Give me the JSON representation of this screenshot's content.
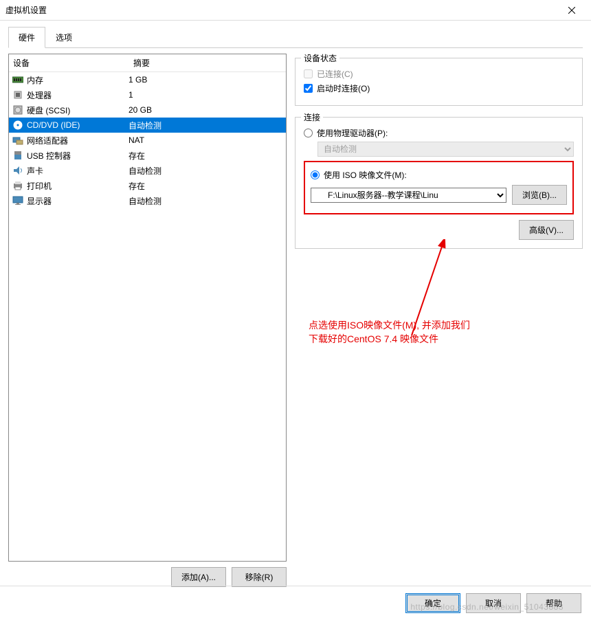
{
  "window": {
    "title": "虚拟机设置"
  },
  "tabs": {
    "hardware": "硬件",
    "options": "选项"
  },
  "hw_header": {
    "device": "设备",
    "summary": "摘要"
  },
  "hw_items": [
    {
      "name": "内存",
      "summary": "1 GB",
      "icon": "memory"
    },
    {
      "name": "处理器",
      "summary": "1",
      "icon": "cpu"
    },
    {
      "name": "硬盘 (SCSI)",
      "summary": "20 GB",
      "icon": "disk"
    },
    {
      "name": "CD/DVD (IDE)",
      "summary": "自动检测",
      "icon": "cd",
      "selected": true
    },
    {
      "name": "网络适配器",
      "summary": "NAT",
      "icon": "net"
    },
    {
      "name": "USB 控制器",
      "summary": "存在",
      "icon": "usb"
    },
    {
      "name": "声卡",
      "summary": "自动检测",
      "icon": "sound"
    },
    {
      "name": "打印机",
      "summary": "存在",
      "icon": "printer"
    },
    {
      "name": "显示器",
      "summary": "自动检测",
      "icon": "display"
    }
  ],
  "buttons": {
    "add": "添加(A)...",
    "remove": "移除(R)"
  },
  "status_box": {
    "legend": "设备状态",
    "connected": "已连接(C)",
    "connect_on_power": "启动时连接(O)"
  },
  "connection_box": {
    "legend": "连接",
    "use_physical": "使用物理驱动器(P):",
    "auto_detect": "自动检测",
    "use_iso": "使用 ISO 映像文件(M):",
    "iso_path": "F:\\Linux服务器--教学课程\\Linu",
    "browse": "浏览(B)...",
    "advanced": "高级(V)..."
  },
  "annotation": {
    "line1": "点选使用ISO映像文件(M), 并添加我们",
    "line2": "下载好的CentOS 7.4 映像文件"
  },
  "footer": {
    "ok": "确定",
    "cancel": "取消",
    "help": "帮助"
  },
  "watermark": "https://blog.csdn.net/weixin_51043383"
}
